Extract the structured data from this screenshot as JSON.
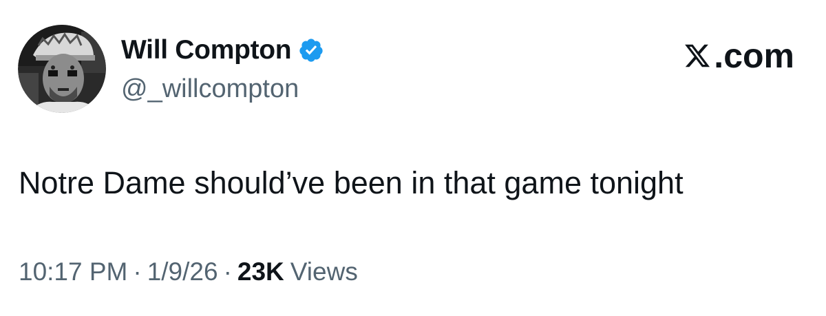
{
  "author": {
    "display_name": "Will Compton",
    "handle": "@_willcompton",
    "verified": true
  },
  "brand": {
    "label": ".com"
  },
  "tweet": {
    "text": "Notre Dame should’ve been in that game tonight"
  },
  "meta": {
    "time": "10:17 PM",
    "separator": "·",
    "date": "1/9/26",
    "views_count": "23K",
    "views_label": "Views"
  },
  "colors": {
    "text_primary": "#0f1419",
    "text_secondary": "#536471",
    "verified_blue": "#1d9bf0",
    "background": "#ffffff"
  },
  "icons": {
    "verified": "verified-badge-icon",
    "brand": "x-logo-icon"
  }
}
